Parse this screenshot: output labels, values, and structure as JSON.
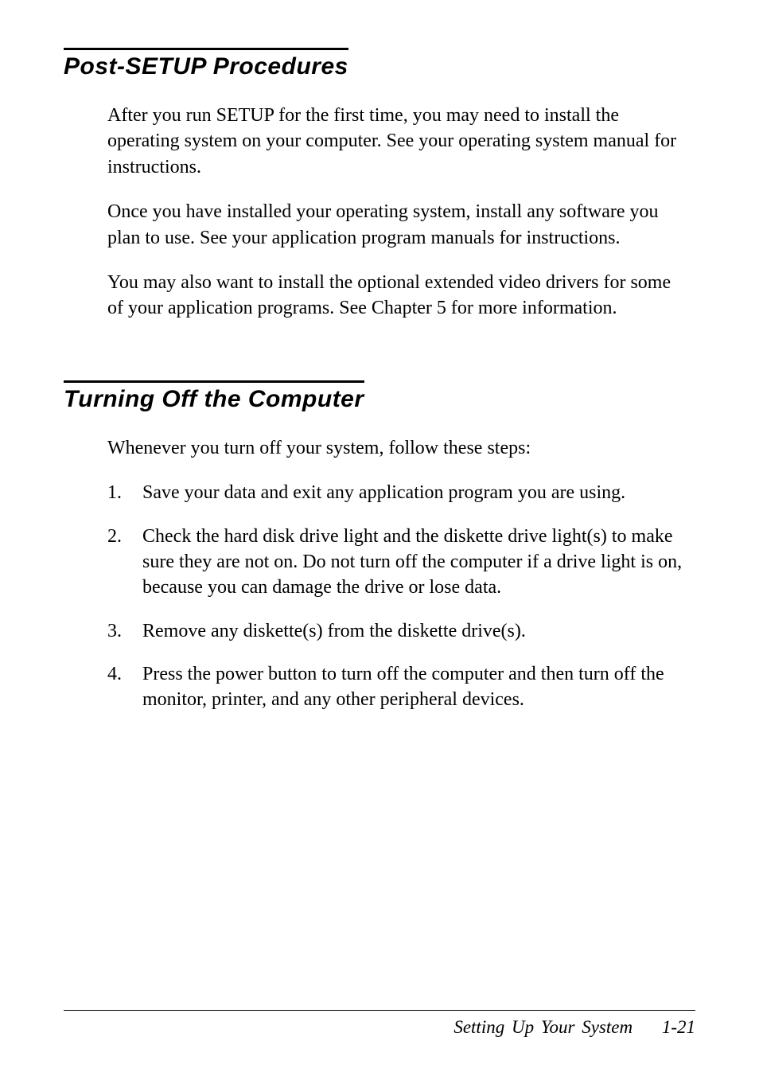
{
  "section1": {
    "heading": "Post-SETUP Procedures",
    "paragraphs": [
      "After you run SETUP for the first time, you may need to install the operating system on your computer. See your operating system manual for instructions.",
      "Once you have installed your operating system, install any software you plan to use. See your application program manuals for instructions.",
      "You may also want to install the optional extended video drivers for some of your application programs. See Chapter 5 for more information."
    ]
  },
  "section2": {
    "heading": "Turning Off the Computer",
    "intro": "Whenever you turn off your system, follow these steps:",
    "steps": [
      {
        "num": "1.",
        "text": "Save your data and exit any application program you are using."
      },
      {
        "num": "2.",
        "text": "Check the hard disk drive light and the diskette drive light(s) to make sure they are not on. Do not turn off the computer if a drive light is on, because you can damage the drive or lose data."
      },
      {
        "num": "3.",
        "text": "Remove any diskette(s) from the diskette drive(s)."
      },
      {
        "num": "4.",
        "text": "Press the power button to turn off the computer and then turn off the monitor, printer, and any other peripheral devices."
      }
    ]
  },
  "footer": {
    "label": "Setting Up Your System",
    "page": "1-21"
  }
}
